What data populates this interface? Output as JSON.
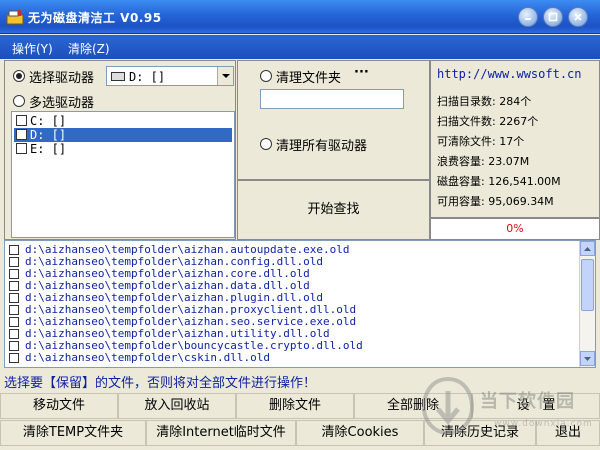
{
  "window": {
    "title": "无为磁盘清洁工 V0.95"
  },
  "menu": {
    "items": [
      "操作(Y)",
      "清除(Z)"
    ]
  },
  "drive_select": {
    "single_label": "选择驱动器",
    "combo_value": "D: []",
    "multi_label": "多选驱动器",
    "drives": [
      "C: []",
      "D: []",
      "E: []"
    ],
    "selected_index": 1
  },
  "clean": {
    "folder_label": "清理文件夹",
    "browse_label": "···",
    "folder_value": "",
    "all_drives_label": "清理所有驱动器",
    "start_label": "开始查找"
  },
  "info": {
    "url": "http://www.wwsoft.cn",
    "rows": [
      "扫描目录数: 284个",
      "扫描文件数: 2267个",
      "可清除文件: 17个",
      "浪费容量:   23.07M",
      "磁盘容量: 126,541.00M",
      "可用容量: 95,069.34M"
    ],
    "progress_text": "0%",
    "progress_value": 0
  },
  "files": [
    "d:\\aizhanseo\\tempfolder\\aizhan.autoupdate.exe.old",
    "d:\\aizhanseo\\tempfolder\\aizhan.config.dll.old",
    "d:\\aizhanseo\\tempfolder\\aizhan.core.dll.old",
    "d:\\aizhanseo\\tempfolder\\aizhan.data.dll.old",
    "d:\\aizhanseo\\tempfolder\\aizhan.plugin.dll.old",
    "d:\\aizhanseo\\tempfolder\\aizhan.proxyclient.dll.old",
    "d:\\aizhanseo\\tempfolder\\aizhan.seo.service.exe.old",
    "d:\\aizhanseo\\tempfolder\\aizhan.utility.dll.old",
    "d:\\aizhanseo\\tempfolder\\bouncycastle.crypto.dll.old",
    "d:\\aizhanseo\\tempfolder\\cskin.dll.old"
  ],
  "status": "选择要【保留】的文件，否则将对全部文件进行操作！",
  "buttons_row1": [
    "移动文件",
    "放入回收站",
    "删除文件",
    "全部删除",
    "设　置"
  ],
  "buttons_row2": [
    "清除TEMP文件夹",
    "清除Internet临时文件",
    "清除Cookies",
    "清除历史记录",
    "退出"
  ],
  "watermark": {
    "text": "当下软件园",
    "sub": "www.downxia.com"
  },
  "colors": {
    "title_blue": "#2565d8",
    "selection": "#316ac5",
    "link_blue": "#0b1fa6",
    "progress_red": "#d01010"
  }
}
